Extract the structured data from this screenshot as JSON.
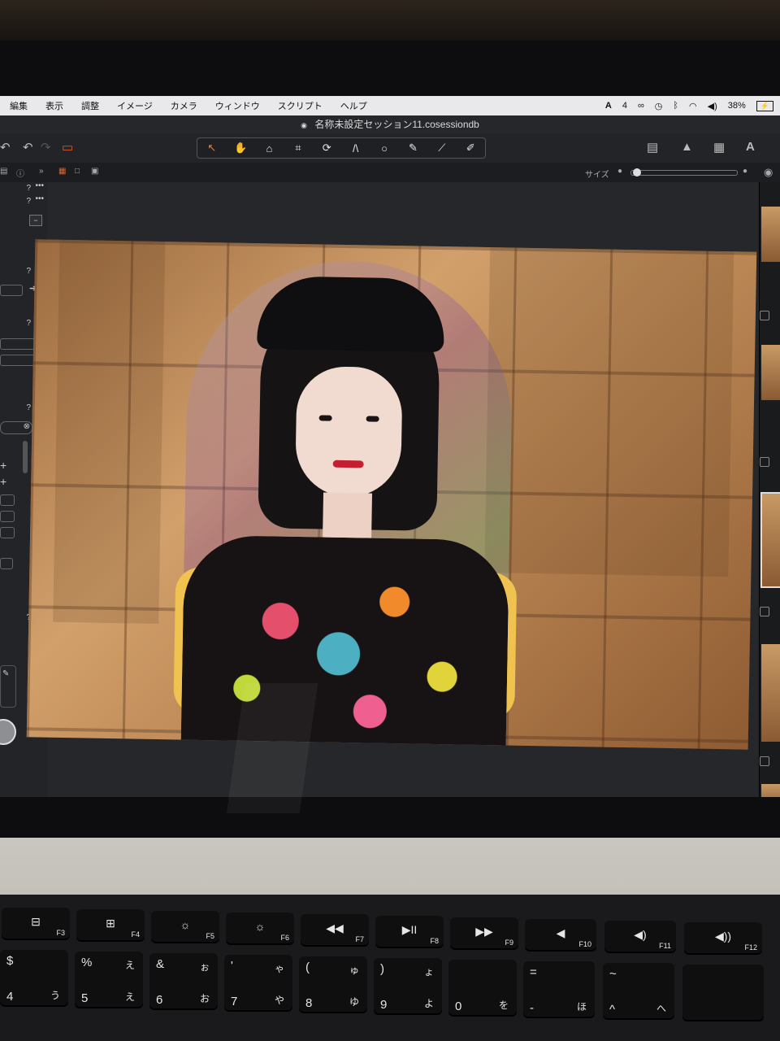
{
  "menubar": {
    "items": [
      "編集",
      "表示",
      "調整",
      "イメージ",
      "カメラ",
      "ウィンドウ",
      "スクリプト",
      "ヘルプ"
    ],
    "adobe_count": "4",
    "battery": "38%"
  },
  "window": {
    "title": "名称未設定セッション11.cosessiondb"
  },
  "subbar": {
    "size_label": "サイズ"
  },
  "sidebar": {
    "help": "?",
    "more": "•••"
  },
  "keyboard": {
    "fkeys": [
      {
        "fn": "F3",
        "glyph": "⊟"
      },
      {
        "fn": "F4",
        "glyph": "⊞"
      },
      {
        "fn": "F5",
        "glyph": "☼"
      },
      {
        "fn": "F6",
        "glyph": "☼"
      },
      {
        "fn": "F7",
        "glyph": "◀◀"
      },
      {
        "fn": "F8",
        "glyph": "▶II"
      },
      {
        "fn": "F9",
        "glyph": "▶▶"
      },
      {
        "fn": "F10",
        "glyph": "◀"
      },
      {
        "fn": "F11",
        "glyph": "◀)"
      },
      {
        "fn": "F12",
        "glyph": "◀))"
      }
    ],
    "numkeys": [
      {
        "tl": "$",
        "bl": "4",
        "tr": "",
        "br": "う"
      },
      {
        "tl": "%",
        "bl": "5",
        "tr": "え",
        "br": "え"
      },
      {
        "tl": "&",
        "bl": "6",
        "tr": "ぉ",
        "br": "お"
      },
      {
        "tl": "'",
        "bl": "7",
        "tr": "ゃ",
        "br": "や"
      },
      {
        "tl": "(",
        "bl": "8",
        "tr": "ゅ",
        "br": "ゆ"
      },
      {
        "tl": ")",
        "bl": "9",
        "tr": "ょ",
        "br": "よ"
      },
      {
        "tl": "",
        "bl": "0",
        "tr": "",
        "br": "を"
      },
      {
        "tl": "=",
        "bl": "-",
        "tr": "",
        "br": "ほ"
      },
      {
        "tl": "~",
        "bl": "^",
        "tr": "",
        "br": "へ"
      }
    ]
  }
}
